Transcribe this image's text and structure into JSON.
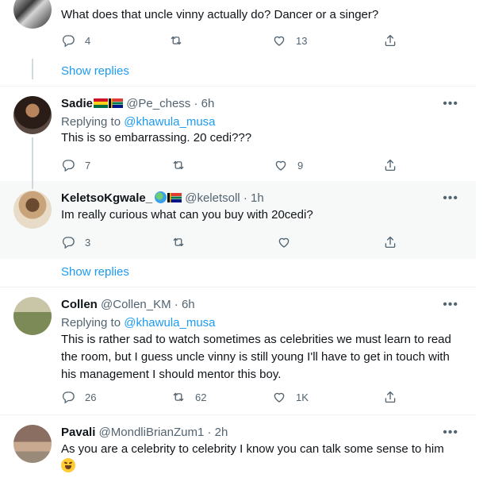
{
  "tweets": [
    {
      "text": "What does that uncle vinny actually do? Dancer or a singer?",
      "reply_count": "4",
      "retweet_count": "",
      "like_count": "13"
    },
    {
      "name": "Sadie",
      "handle": "@Pe_chess",
      "time": "6h",
      "replying_label": "Replying to",
      "replying_to": "@khawula_musa",
      "text": "This is so embarrassing. 20 cedi???",
      "reply_count": "7",
      "retweet_count": "",
      "like_count": "9"
    },
    {
      "name": "KeletsoKgwale_",
      "handle": "@keletsoll",
      "time": "1h",
      "text": "Im really curious what can you buy with 20cedi?",
      "reply_count": "3",
      "retweet_count": "",
      "like_count": ""
    },
    {
      "name": "Collen",
      "handle": "@Collen_KM",
      "time": "6h",
      "replying_label": "Replying to",
      "replying_to": "@khawula_musa",
      "text": "This is rather sad to watch sometimes as celebrities we must learn to read the room, but I guess uncle vinny is still young I'll have to get in touch with his management I should mentor this boy.",
      "reply_count": "26",
      "retweet_count": "62",
      "like_count": "1K"
    },
    {
      "name": "Pavali",
      "handle": "@MondliBrianZum1",
      "time": "2h",
      "text": "As you are a celebrity to celebrity I know you can talk some sense to him"
    }
  ],
  "show_replies_label": "Show replies",
  "separator_dot": "·",
  "icons": {
    "reply": "reply-icon",
    "retweet": "retweet-icon",
    "like": "heart-icon",
    "share": "share-icon",
    "more": "more-icon"
  },
  "colors": {
    "link": "#1d9bf0",
    "secondary_text": "#536471",
    "highlight_bg": "#f7f9f9"
  }
}
